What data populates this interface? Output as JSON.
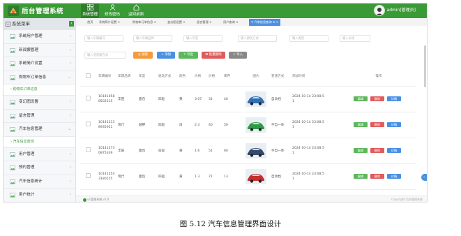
{
  "app": {
    "title": "后台管理系统"
  },
  "top_nav": [
    {
      "label": "系统管理",
      "icon": "grid-icon",
      "active": true
    },
    {
      "label": "修改密码",
      "icon": "user-icon",
      "active": false
    },
    {
      "label": "返回桌面",
      "icon": "home-icon",
      "active": false
    }
  ],
  "user": {
    "name": "admin[管理员]"
  },
  "sidebar": {
    "header": "系统菜单",
    "collapse_icon": "chevron-left-icon",
    "items": [
      {
        "label": "系统用户管理",
        "type": "item"
      },
      {
        "label": "新闻搬管理",
        "type": "item"
      },
      {
        "label": "系统简介设置",
        "type": "item"
      },
      {
        "label": "购物车订单信息",
        "type": "item",
        "expanded": true
      },
      {
        "label": "购物车订单信息",
        "type": "sub"
      },
      {
        "label": "变幻图设置",
        "type": "item"
      },
      {
        "label": "留言管理",
        "type": "item"
      },
      {
        "label": "汽车信息管理",
        "type": "item",
        "expanded": true
      },
      {
        "label": "汽车信息查询",
        "type": "sub"
      },
      {
        "label": "用户管理",
        "type": "item"
      },
      {
        "label": "预约管理",
        "type": "item"
      },
      {
        "label": "汽车信息统计",
        "type": "item"
      },
      {
        "label": "用户统计",
        "type": "item"
      }
    ]
  },
  "tabs": [
    {
      "label": "首页",
      "active": false
    },
    {
      "label": "系统简介设置",
      "active": false
    },
    {
      "label": "购物车订单信息",
      "active": false
    },
    {
      "label": "变幻图设置",
      "active": false
    },
    {
      "label": "留言管理",
      "active": false
    },
    {
      "label": "用户查询",
      "active": false
    },
    {
      "label": "汽车信息查询",
      "active": true
    }
  ],
  "filters": {
    "row1": [
      "输入车辆编号",
      "输入车辆品牌",
      "输入车型",
      "输入颜色方式",
      "输入类型",
      "输入价格"
    ],
    "row2": [
      "输入变速箱方式"
    ],
    "buttons": [
      {
        "label": "搜索",
        "icon": "search-icon",
        "color": "#f39c3c"
      },
      {
        "label": "添加",
        "icon": "plus-icon",
        "color": "#4a90e2"
      },
      {
        "label": "导出",
        "icon": "export-icon",
        "color": "#5cb85c"
      },
      {
        "label": "批量删除",
        "icon": "trash-icon",
        "color": "#e05c5c"
      },
      {
        "label": "导入",
        "icon": "import-icon",
        "color": "#888888"
      }
    ]
  },
  "table": {
    "columns": [
      "",
      "车辆编号",
      "车辆品牌",
      "车型",
      "驱动方式",
      "颜色",
      "价格",
      "价格",
      "库存",
      "图片",
      "变速方式",
      "添加时间",
      "操作"
    ],
    "actions": {
      "edit": "编辑",
      "delete": "删除",
      "detail": "详情"
    },
    "rows": [
      {
        "id_lines": [
          "10141058",
          "8502215"
        ],
        "brand": "丰田",
        "model": "面包",
        "drive": "四驱",
        "color": "黄",
        "price": "3.07",
        "price2": "31",
        "stock": "40",
        "image": "blue-car-thumbnail",
        "trans": "自动档",
        "time_lines": [
          "2024-10-14 23:08:5",
          "1"
        ]
      },
      {
        "id_lines": [
          "10141233",
          "8935921"
        ],
        "brand": "现代",
        "model": "越野",
        "drive": "四驱",
        "color": "白",
        "price": "2.3",
        "price2": "40",
        "stock": "50",
        "image": "green-car-thumbnail",
        "trans": "手自一体",
        "time_lines": [
          "2024-10-14 23:08:5",
          "1"
        ]
      },
      {
        "id_lines": [
          "10141273",
          "0875339"
        ],
        "brand": "丰田",
        "model": "面包",
        "drive": "前驱",
        "color": "黄",
        "price": "1.6",
        "price2": "51",
        "stock": "60",
        "image": "navy-car-thumbnail",
        "trans": "手自一体",
        "time_lines": [
          "2024-10-14 23:08:5",
          "1"
        ]
      },
      {
        "id_lines": [
          "10141254",
          "3180155"
        ],
        "brand": "现代",
        "model": "面包",
        "drive": "四驱",
        "color": "黄",
        "price": "1.3",
        "price2": "71",
        "stock": "13",
        "image": "red-car-thumbnail",
        "trans": "自动档",
        "time_lines": [
          "2024-10-14 23:08:5",
          "1"
        ]
      }
    ]
  },
  "footer": {
    "left": "v1管理系统 v1.0",
    "right": "Copyright 后台管理系统"
  },
  "caption": "图 5.12  汽车信息管理界面设计",
  "colors": {
    "header": "#3a9a36",
    "edit": "#5cb85c",
    "delete": "#e05c5c",
    "detail": "#4a90e2"
  }
}
